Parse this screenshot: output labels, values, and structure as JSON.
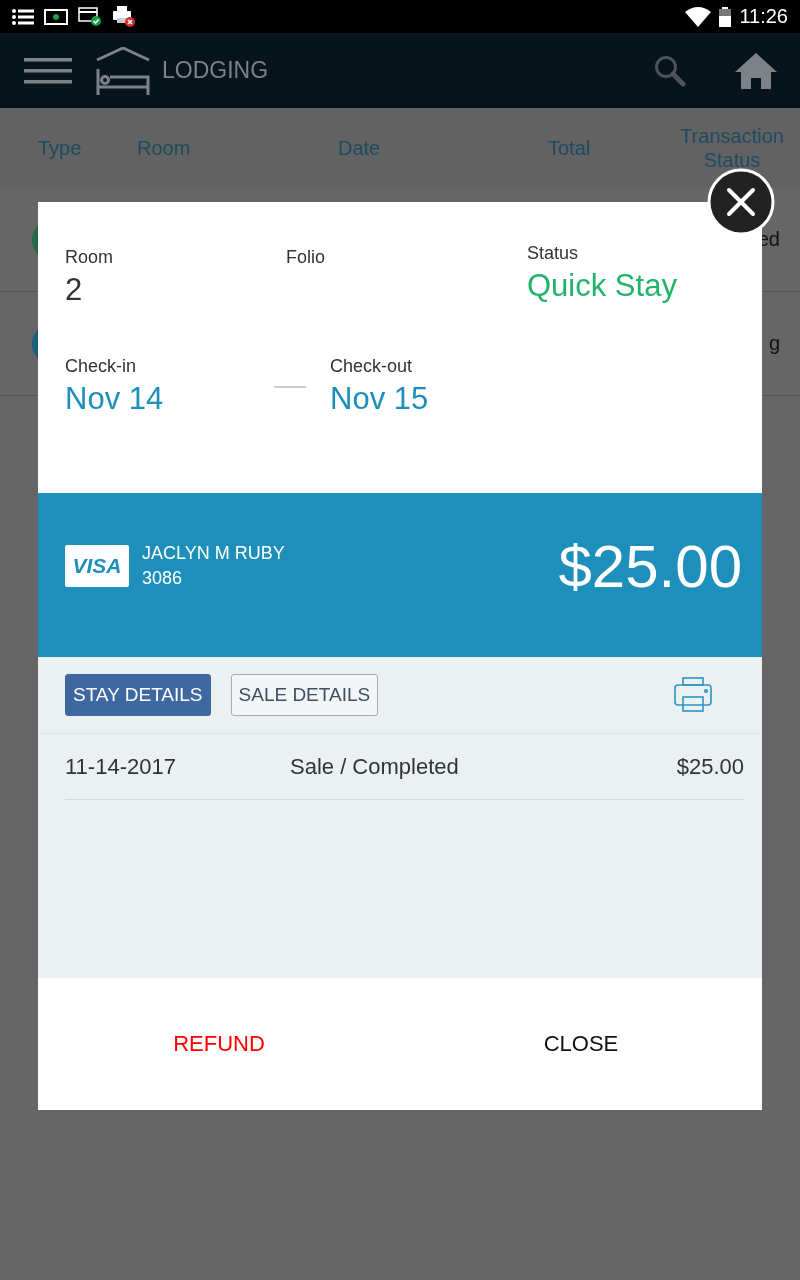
{
  "status_bar": {
    "time": "11:26"
  },
  "app_bar": {
    "title": "LODGING"
  },
  "table": {
    "columns": [
      "Type",
      "Room",
      "Date",
      "Total",
      "Transaction Status"
    ],
    "rows": [
      {
        "color": "#1d6b47",
        "status": "ed"
      },
      {
        "color": "#1b5f80",
        "status": "g"
      }
    ]
  },
  "dialog": {
    "room": {
      "label": "Room",
      "value": "2"
    },
    "folio": {
      "label": "Folio"
    },
    "status": {
      "label": "Status",
      "value": "Quick Stay"
    },
    "check_in": {
      "label": "Check-in",
      "value": "Nov 14"
    },
    "check_out": {
      "label": "Check-out",
      "value": "Nov 15"
    },
    "payment": {
      "card_brand": "VISA",
      "holder": "JACLYN M RUBY",
      "last_digits": "3086",
      "amount": "$25.00"
    },
    "tabs": [
      {
        "label": "STAY DETAILS",
        "selected": true
      },
      {
        "label": "SALE DETAILS",
        "selected": false
      }
    ],
    "transactions": [
      {
        "date": "11-14-2017",
        "description": "Sale / Completed",
        "amount": "$25.00"
      }
    ],
    "buttons": [
      {
        "label": "REFUND",
        "kind": "danger"
      },
      {
        "label": "CLOSE",
        "kind": "default"
      }
    ]
  }
}
